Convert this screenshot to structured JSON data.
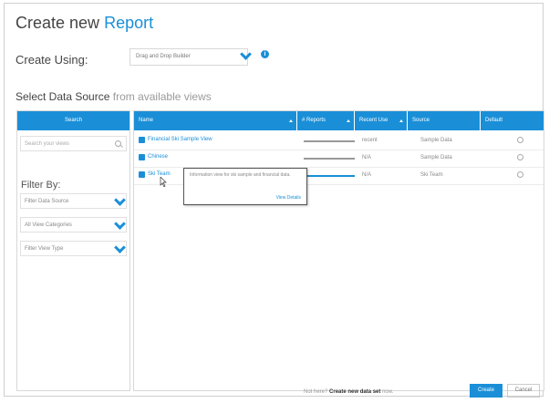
{
  "header": {
    "title_prefix": "Create new",
    "title_accent": "Report"
  },
  "create_using": {
    "label": "Create Using:",
    "value": "Drag and Drop Builder"
  },
  "section": {
    "title_primary": "Select Data Source",
    "title_secondary": "from available views"
  },
  "left_panel": {
    "header": "Search",
    "search_placeholder": "Search your views",
    "filter_title": "Filter By:",
    "filters": [
      "Filter Data Source",
      "All View Categories",
      "Filter View Type"
    ]
  },
  "table": {
    "columns": [
      "Name",
      "# Reports",
      "Recent Use",
      "Source",
      "Default"
    ],
    "rows": [
      {
        "name": "Financial Ski Sample View",
        "recent": "recent",
        "source": "Sample Data"
      },
      {
        "name": "Chinese",
        "recent": "N/A",
        "source": "Sample Data"
      },
      {
        "name": "Ski Team",
        "recent": "N/A",
        "source": "Ski Team"
      }
    ]
  },
  "tooltip": {
    "text": "Information view for ski sample and financial data.",
    "link": "View Details"
  },
  "footer": {
    "prefix": "Not here?",
    "link": "Create new data set",
    "suffix": "now.",
    "create": "Create",
    "cancel": "Cancel"
  },
  "colors": {
    "accent": "#1a8fd8"
  }
}
